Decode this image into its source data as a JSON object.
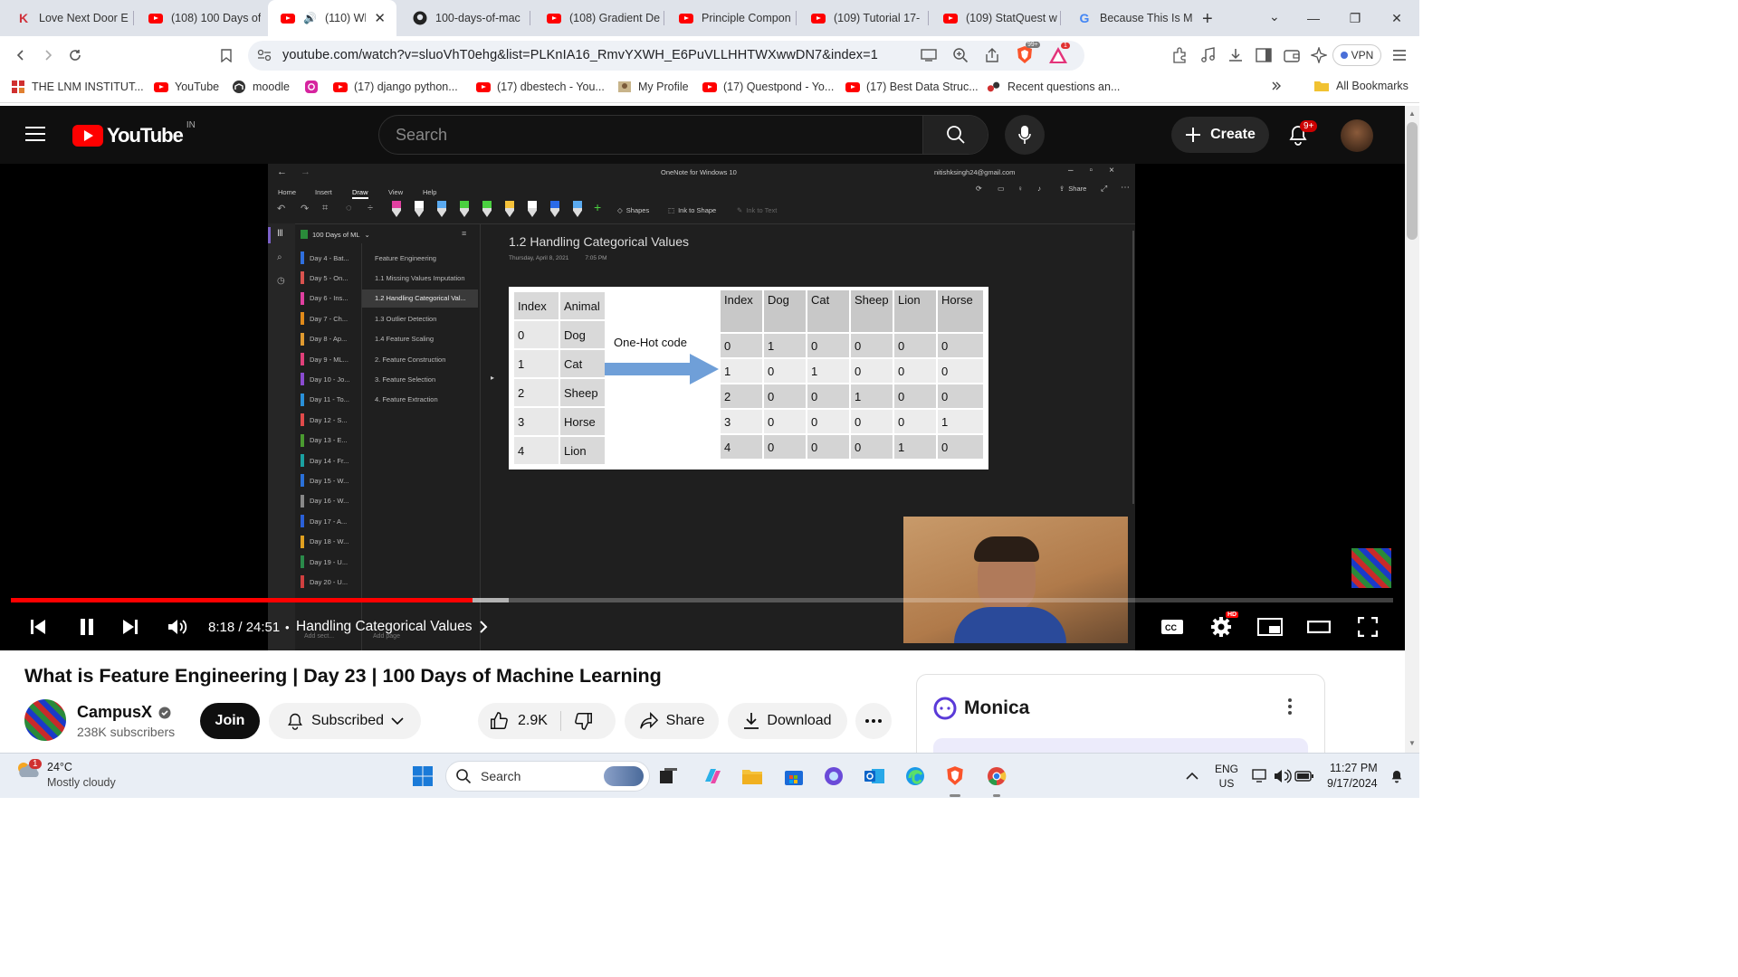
{
  "browser": {
    "tabs": [
      {
        "title": "Love Next Door E",
        "icon": "k-icon"
      },
      {
        "title": "(108) 100 Days of",
        "icon": "youtube-icon"
      },
      {
        "title": "(110) Wha",
        "icon": "youtube-icon",
        "active": true
      },
      {
        "title": "100-days-of-mac",
        "icon": "github-icon"
      },
      {
        "title": "(108) Gradient De",
        "icon": "youtube-icon"
      },
      {
        "title": "Principle Compon",
        "icon": "youtube-icon"
      },
      {
        "title": "(109) Tutorial 17-",
        "icon": "youtube-icon"
      },
      {
        "title": "(109) StatQuest w",
        "icon": "youtube-icon"
      },
      {
        "title": "Because This Is M",
        "icon": "google-icon"
      }
    ],
    "url": "youtube.com/watch?v=sluoVhT0ehg&list=PLKnIA16_RmvYXWH_E6PuVLLHHTWXwwDN7&index=1",
    "brave_badge": "99+",
    "alert_badge": "1",
    "vpn_label": "VPN",
    "bookmarks": [
      {
        "label": "THE LNM INSTITUT...",
        "icon": "lnm-icon"
      },
      {
        "label": "YouTube",
        "icon": "youtube-icon"
      },
      {
        "label": "moodle",
        "icon": "moodle-icon"
      },
      {
        "label": "",
        "icon": "instagram-icon"
      },
      {
        "label": "(17) django python...",
        "icon": "youtube-icon"
      },
      {
        "label": "(17) dbestech - You...",
        "icon": "youtube-icon"
      },
      {
        "label": "My Profile",
        "icon": "profile-icon"
      },
      {
        "label": "(17) Questpond - Yo...",
        "icon": "youtube-icon"
      },
      {
        "label": "(17) Best Data Struc...",
        "icon": "youtube-icon"
      },
      {
        "label": "Recent questions an...",
        "icon": "brainly-icon"
      }
    ],
    "all_bookmarks": "All Bookmarks"
  },
  "youtube": {
    "logo_text": "YouTube",
    "region": "IN",
    "search_placeholder": "Search",
    "create_label": "Create",
    "notif_badge": "9+"
  },
  "onenote": {
    "window_title": "OneNote for Windows 10",
    "account": "nitishksingh24@gmail.com",
    "share": "Share",
    "ribbon_tabs": [
      "Home",
      "Insert",
      "Draw",
      "View",
      "Help"
    ],
    "tools": [
      "Shapes",
      "Ink to Shape",
      "Ink to Text"
    ],
    "notebook": "100 Days of ML",
    "sections": [
      {
        "label": "Day 4 - Bat...",
        "color": "#2f6fde"
      },
      {
        "label": "Day 5 - On...",
        "color": "#d9534f"
      },
      {
        "label": "Day 6 - Ins...",
        "color": "#e040a0"
      },
      {
        "label": "Day 7 - Ch...",
        "color": "#e08a1a"
      },
      {
        "label": "Day 8 - Ap...",
        "color": "#e09a30"
      },
      {
        "label": "Day 9 - ML...",
        "color": "#e0407a"
      },
      {
        "label": "Day 10 - Jo...",
        "color": "#8a4bd0"
      },
      {
        "label": "Day 11 - To...",
        "color": "#2a90d8"
      },
      {
        "label": "Day 12 - S...",
        "color": "#e04a4a"
      },
      {
        "label": "Day 13 - E...",
        "color": "#4a9a30"
      },
      {
        "label": "Day 14 - Fr...",
        "color": "#1aa0a0"
      },
      {
        "label": "Day 15 - W...",
        "color": "#2a70d8"
      },
      {
        "label": "Day 16 - W...",
        "color": "#888888"
      },
      {
        "label": "Day 17 - A...",
        "color": "#2a60d8"
      },
      {
        "label": "Day 18 - W...",
        "color": "#e0a020"
      },
      {
        "label": "Day 19 - U...",
        "color": "#2a8a4a"
      },
      {
        "label": "Day 20 - U...",
        "color": "#d04040"
      }
    ],
    "pages": [
      {
        "label": "Feature Engineering",
        "indent": 0
      },
      {
        "label": "1.1 Missing Values Imputation",
        "indent": 0
      },
      {
        "label": "1.2 Handling Categorical Val...",
        "indent": 0,
        "selected": true
      },
      {
        "label": "1.3 Outlier Detection",
        "indent": 0
      },
      {
        "label": "1.4 Feature Scaling",
        "indent": 0
      },
      {
        "label": "2. Feature Construction",
        "indent": 0
      },
      {
        "label": "3. Feature Selection",
        "indent": 0
      },
      {
        "label": "4. Feature Extraction",
        "indent": 0
      }
    ],
    "add_section": "Add sect...",
    "add_page": "Add page",
    "page_title": "1.2 Handling Categorical Values",
    "page_date": "Thursday, April 8, 2021",
    "page_time": "7:05 PM",
    "arrow_label": "One-Hot code",
    "left_table": {
      "headers": [
        "Index",
        "Animal"
      ],
      "rows": [
        [
          "0",
          "Dog"
        ],
        [
          "1",
          "Cat"
        ],
        [
          "2",
          "Sheep"
        ],
        [
          "3",
          "Horse"
        ],
        [
          "4",
          "Lion"
        ]
      ]
    },
    "right_table": {
      "headers": [
        "Index",
        "Dog",
        "Cat",
        "Sheep",
        "Lion",
        "Horse"
      ],
      "rows": [
        [
          "0",
          "1",
          "0",
          "0",
          "0",
          "0"
        ],
        [
          "1",
          "0",
          "1",
          "0",
          "0",
          "0"
        ],
        [
          "2",
          "0",
          "0",
          "1",
          "0",
          "0"
        ],
        [
          "3",
          "0",
          "0",
          "0",
          "0",
          "1"
        ],
        [
          "4",
          "0",
          "0",
          "0",
          "1",
          "0"
        ]
      ]
    }
  },
  "player": {
    "time": "8:18 / 24:51",
    "chapter": "Handling Categorical Values",
    "bullet": "•",
    "progress_fraction": 0.334,
    "hd_badge": "HD"
  },
  "video": {
    "title": "What is Feature Engineering | Day 23 | 100 Days of Machine Learning",
    "channel": "CampusX",
    "subscribers": "238K subscribers",
    "join": "Join",
    "subscribed": "Subscribed",
    "likes": "2.9K",
    "share": "Share",
    "download": "Download"
  },
  "monica": {
    "label": "Monica"
  },
  "taskbar": {
    "temp": "24°C",
    "weather": "Mostly cloudy",
    "weather_badge": "1",
    "search": "Search",
    "lang1": "ENG",
    "lang2": "US",
    "time": "11:27 PM",
    "date": "9/17/2024"
  }
}
